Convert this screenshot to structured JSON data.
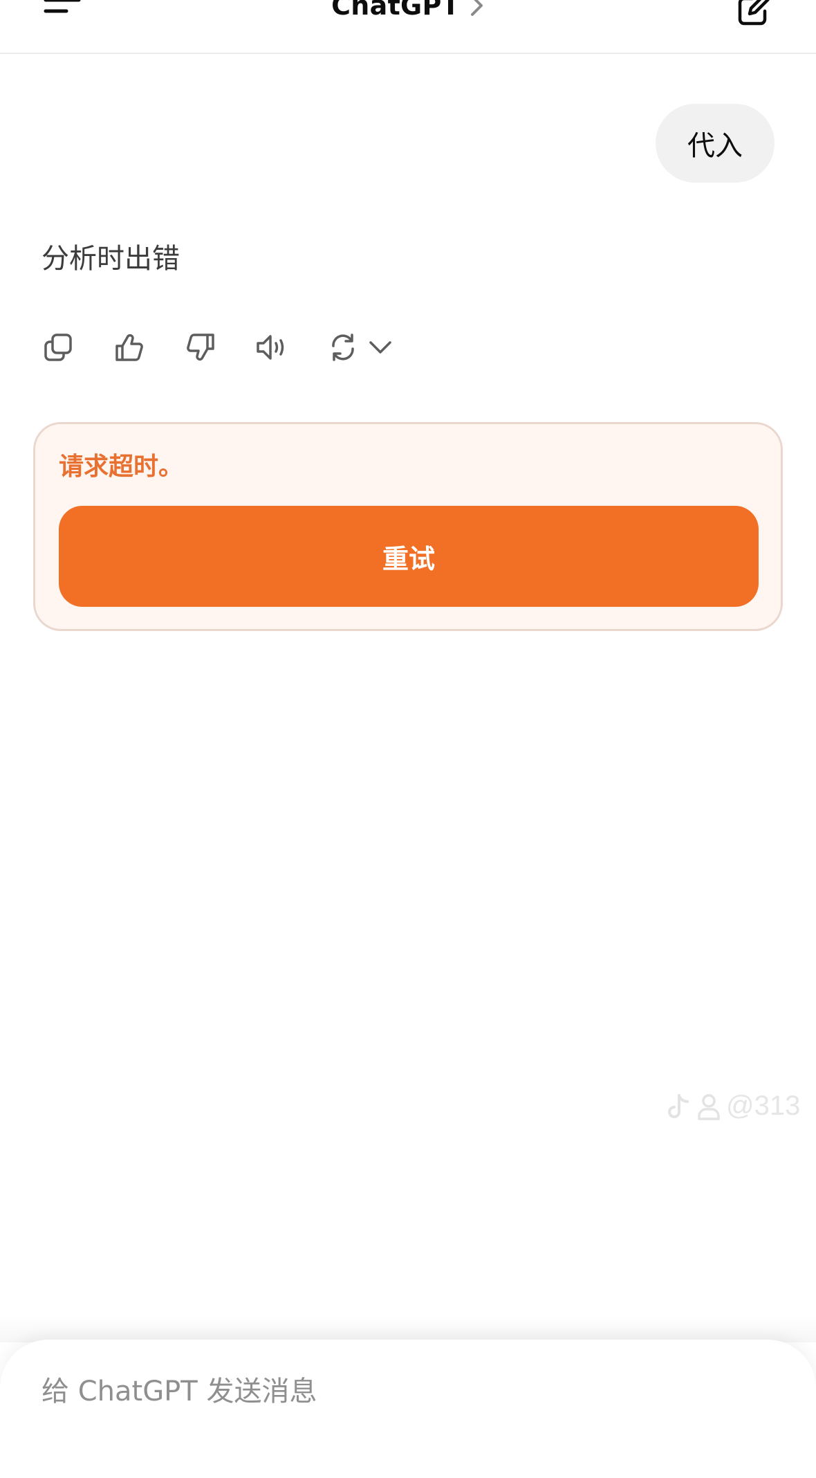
{
  "header": {
    "title": "ChatGPT",
    "menu_icon": "hamburger-menu-icon",
    "title_chevron_icon": "chevron-right-icon",
    "new_chat_icon": "edit-icon"
  },
  "conversation": {
    "user_message": "代入",
    "assistant_message": "分析时出错",
    "actions": [
      {
        "icon": "copy-icon"
      },
      {
        "icon": "thumbs-up-icon"
      },
      {
        "icon": "thumbs-down-icon"
      },
      {
        "icon": "read-aloud-icon"
      },
      {
        "icon": "regenerate-icon"
      },
      {
        "icon": "chevron-down-icon"
      }
    ]
  },
  "error": {
    "message": "请求超时。",
    "retry_label": "重试",
    "accent_color": "#f27026",
    "background_color": "#fff6f2"
  },
  "watermark": {
    "handle": "@313",
    "icons": [
      "tiktok-logo-icon",
      "person-icon"
    ]
  },
  "composer": {
    "placeholder": "给 ChatGPT 发送消息",
    "value": ""
  }
}
